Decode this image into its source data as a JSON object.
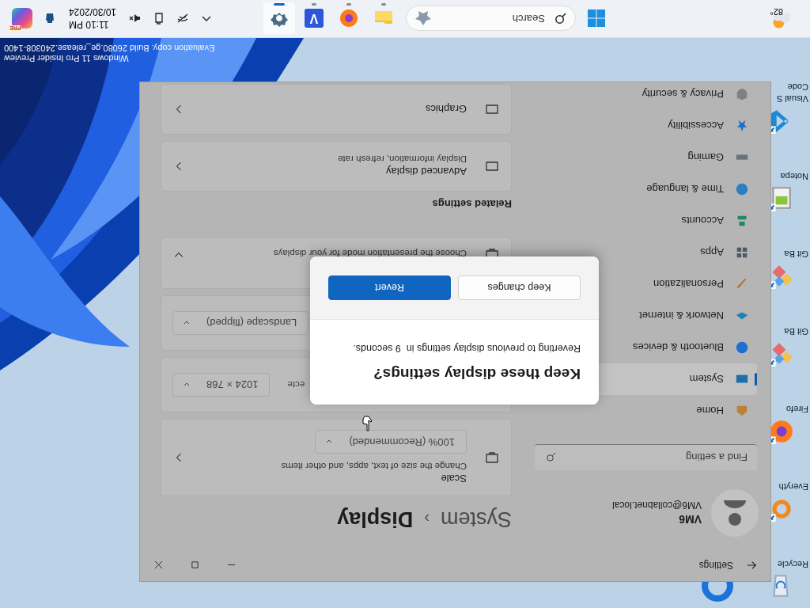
{
  "desktop": {
    "icons": [
      {
        "lines": [
          "Recycle"
        ]
      },
      {
        "lines": [
          "Everyth"
        ]
      },
      {
        "lines": [
          "Firefo"
        ]
      },
      {
        "lines": [
          "Git Ba"
        ]
      },
      {
        "lines": [
          "Git Ba"
        ]
      },
      {
        "lines": [
          "Notepa"
        ]
      },
      {
        "lines": [
          "Visual S",
          "Code"
        ]
      }
    ],
    "watermark": [
      "Windows 11 Pro Insider Preview",
      "Evaluation copy. Build 26080.ge_release.240308-1400"
    ]
  },
  "window": {
    "title": "Settings",
    "user": {
      "name": "VM6",
      "email": "VM6@collabnet.local"
    },
    "search": {
      "placeholder": "Find a setting"
    },
    "nav": [
      {
        "label": "Home",
        "selected": false
      },
      {
        "label": "System",
        "selected": true
      },
      {
        "label": "Bluetooth & devices",
        "selected": false
      },
      {
        "label": "Network & internet",
        "selected": false
      },
      {
        "label": "Personalization",
        "selected": false
      },
      {
        "label": "Apps",
        "selected": false
      },
      {
        "label": "Accounts",
        "selected": false
      },
      {
        "label": "Time & language",
        "selected": false
      },
      {
        "label": "Gaming",
        "selected": false
      },
      {
        "label": "Accessibility",
        "selected": false
      },
      {
        "label": "Privacy & security",
        "selected": false
      }
    ],
    "breadcrumb": {
      "parent": "System",
      "separator": "›",
      "current": "Display"
    },
    "cards": [
      {
        "kind": "link",
        "title": "Scale",
        "description": "Change the size of text, apps, and other items",
        "dropdown": "100% (Recommended)"
      },
      {
        "kind": "covered",
        "fragment": "ecte",
        "dropdown": "1024 × 768"
      },
      {
        "kind": "covered",
        "dropdown": "Landscape (flipped)"
      },
      {
        "kind": "expander",
        "description": "Choose the presentation mode for your displays"
      }
    ],
    "related_heading": "Related settings",
    "related": [
      {
        "kind": "link",
        "title": "Advanced display",
        "description": "Display information, refresh rate"
      },
      {
        "kind": "link",
        "title": "Graphics"
      }
    ]
  },
  "dialog": {
    "title": "Keep these display settings?",
    "message": "Reverting to previous display settings in  9 seconds.",
    "buttons": [
      {
        "label": "Keep changes",
        "primary": false
      },
      {
        "label": "Revert",
        "primary": true
      }
    ]
  },
  "taskbar": {
    "weather": "82°",
    "search": {
      "placeholder": "Search"
    },
    "apps": [
      {
        "selected": false
      },
      {
        "selected": false
      },
      {
        "selected": false,
        "glyph": "V"
      },
      {
        "selected": true
      }
    ],
    "time": "11:10 PM",
    "date": "10/30/2024",
    "badge": "PRE"
  }
}
